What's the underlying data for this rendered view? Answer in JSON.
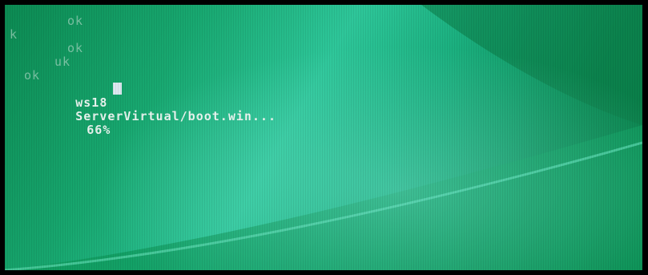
{
  "console": {
    "lines": [
      {
        "text": "ok"
      },
      {
        "text": "k"
      },
      {
        "text": "ok"
      },
      {
        "text": "uk"
      },
      {
        "text": "ok"
      }
    ],
    "progress": {
      "prefix": "ws18",
      "path": "ServerVirtual/boot.win...",
      "percent_text": "66%",
      "percent_value": 66
    }
  },
  "colors": {
    "background_primary": "#18a870",
    "background_highlight": "#2ec79a",
    "text": "#cfe8dc",
    "cursor": "#dfe9f2"
  }
}
